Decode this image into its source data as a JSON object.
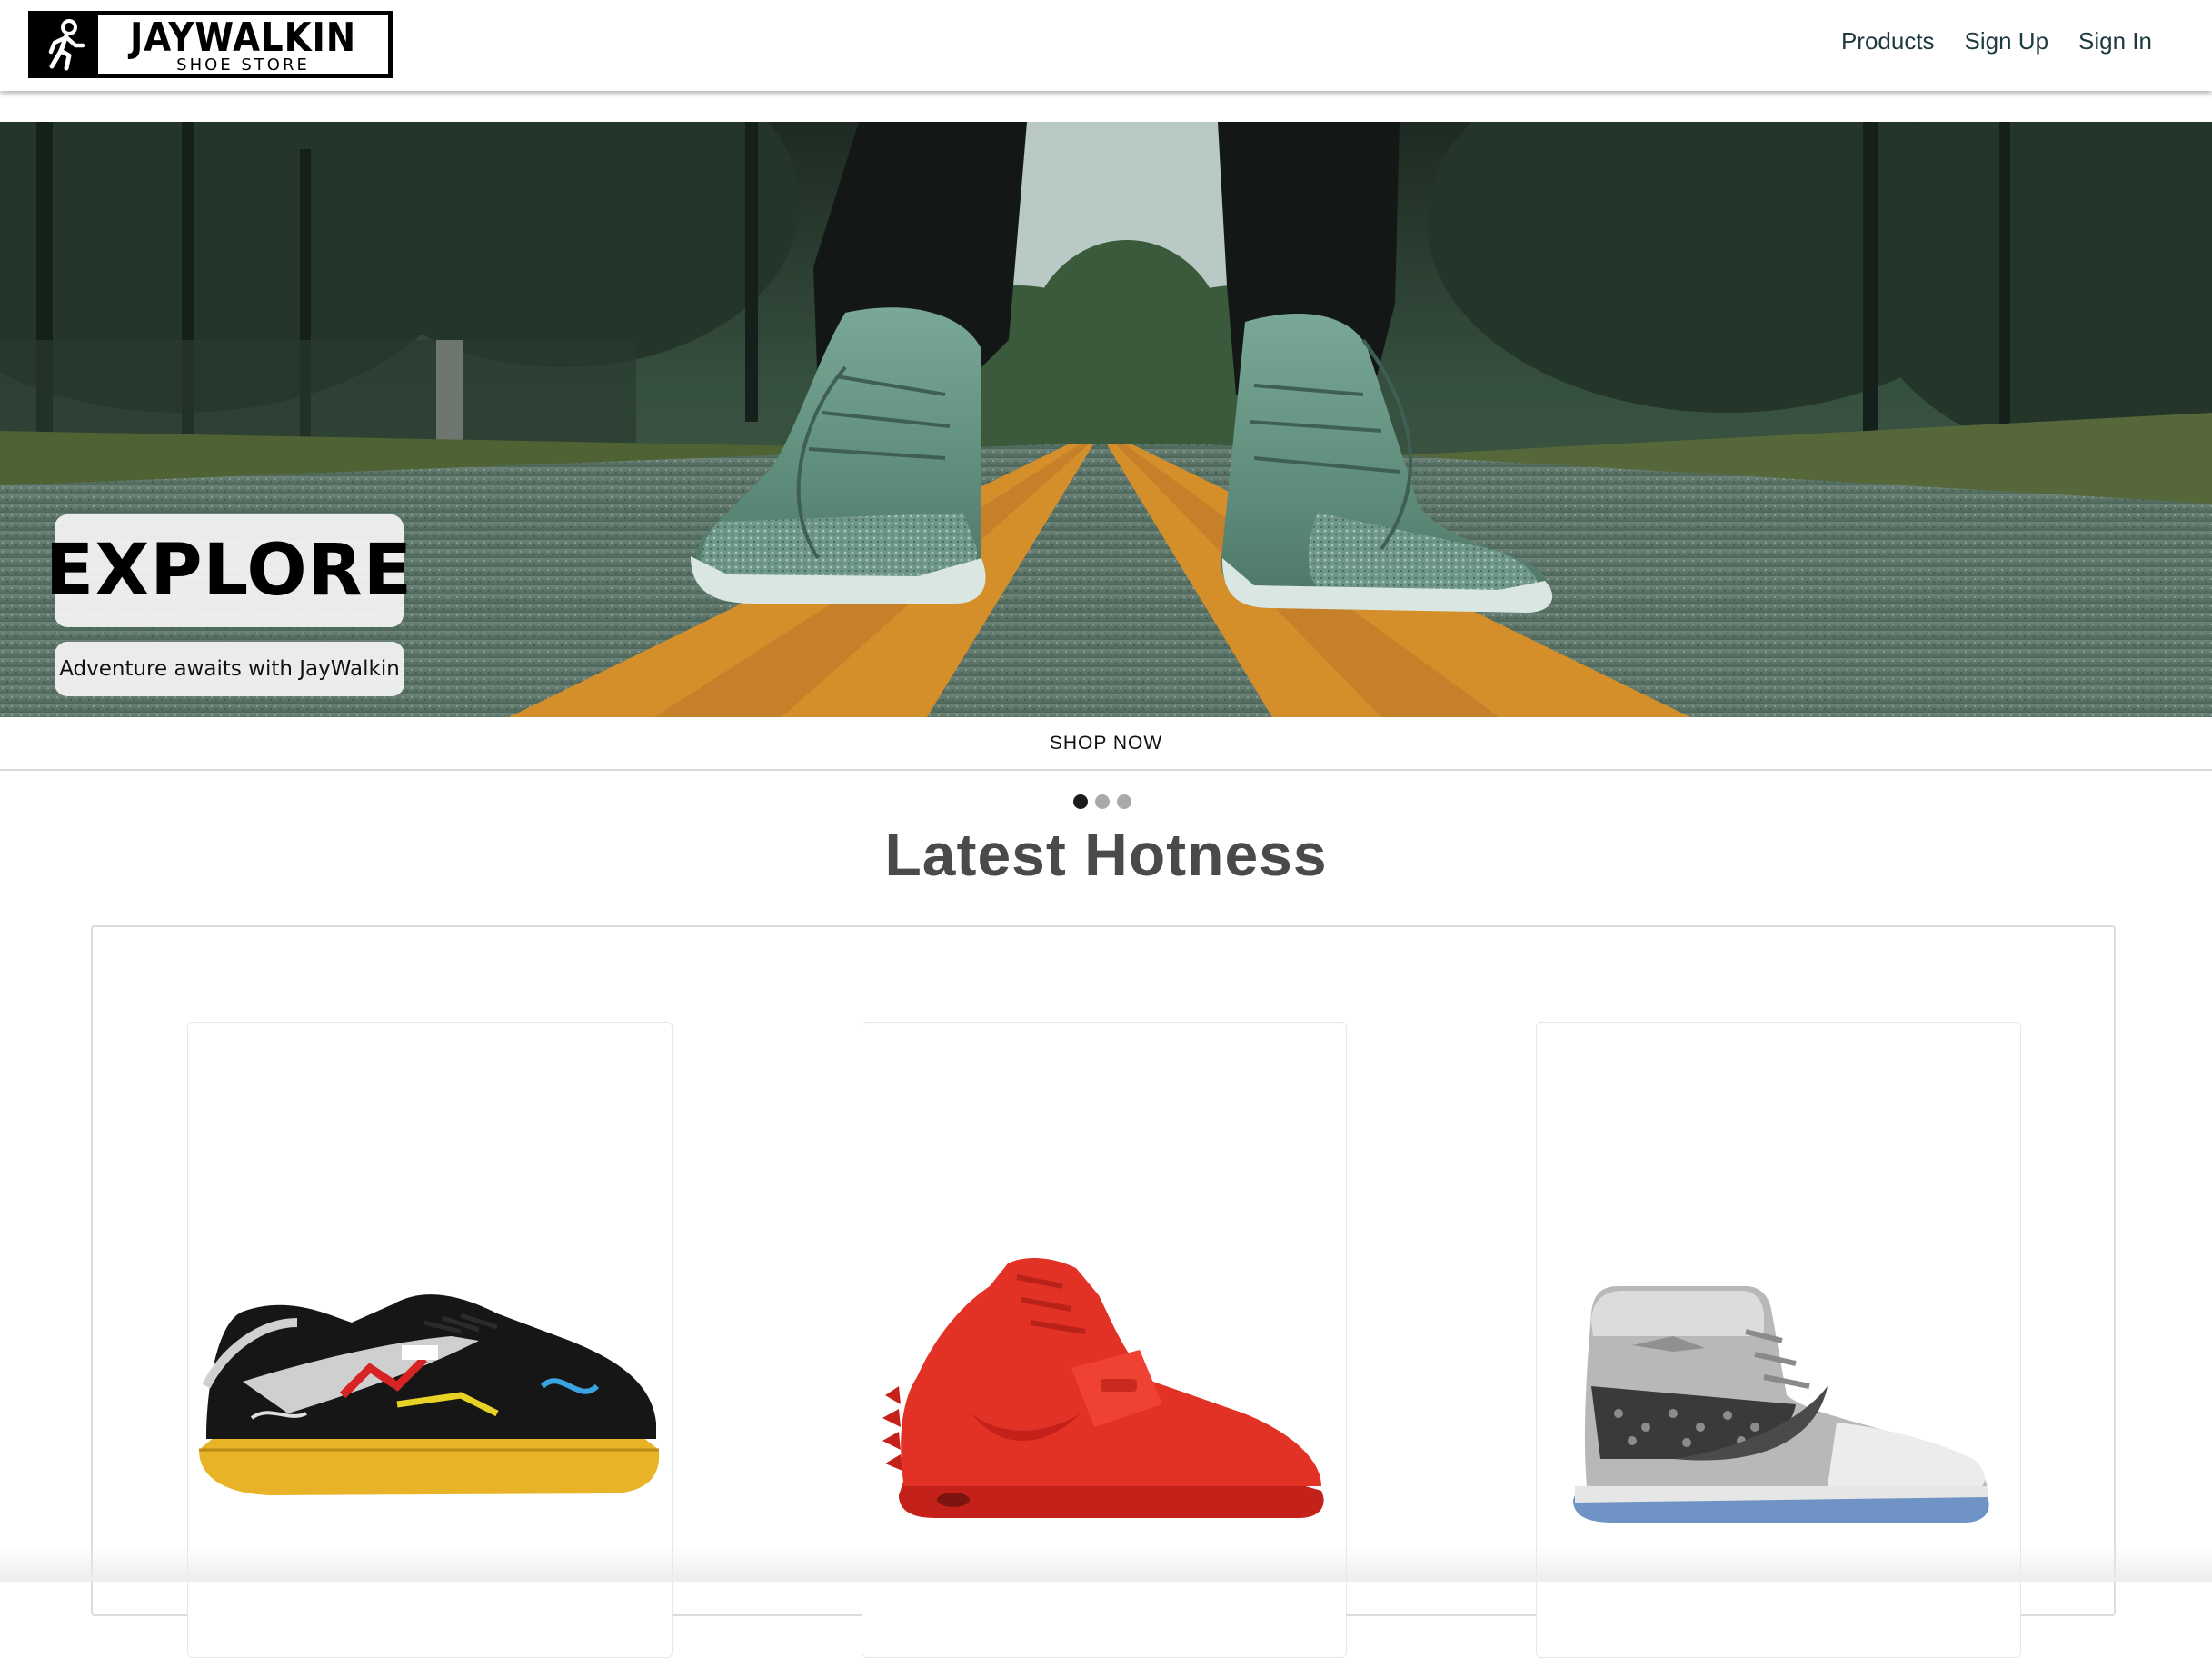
{
  "brand": {
    "name": "JAYWALKIN",
    "tagline": "SHOE STORE",
    "logo_icon": "walking-person-icon"
  },
  "nav": {
    "links": [
      {
        "label": "Products"
      },
      {
        "label": "Sign Up"
      },
      {
        "label": "Sign In"
      }
    ]
  },
  "hero": {
    "title": "EXPLORE",
    "subtitle": "Adventure awaits with JayWalkin",
    "cta": "SHOP NOW",
    "slides_total": 3,
    "active_slide": 1
  },
  "latest": {
    "heading": "Latest Hotness",
    "products": [
      {
        "image": "sneaker-graffiti-suede-yellow-sole"
      },
      {
        "image": "sneaker-red-high-top-strap"
      },
      {
        "image": "sneaker-grey-high-top-monogram"
      }
    ]
  },
  "colors": {
    "nav_text": "#1f3a3f",
    "title_text": "#4a4a4a",
    "road_stripe": "#d48f2a",
    "dot_active": "#1b1b1b",
    "dot_inactive": "#a9a9a9"
  }
}
